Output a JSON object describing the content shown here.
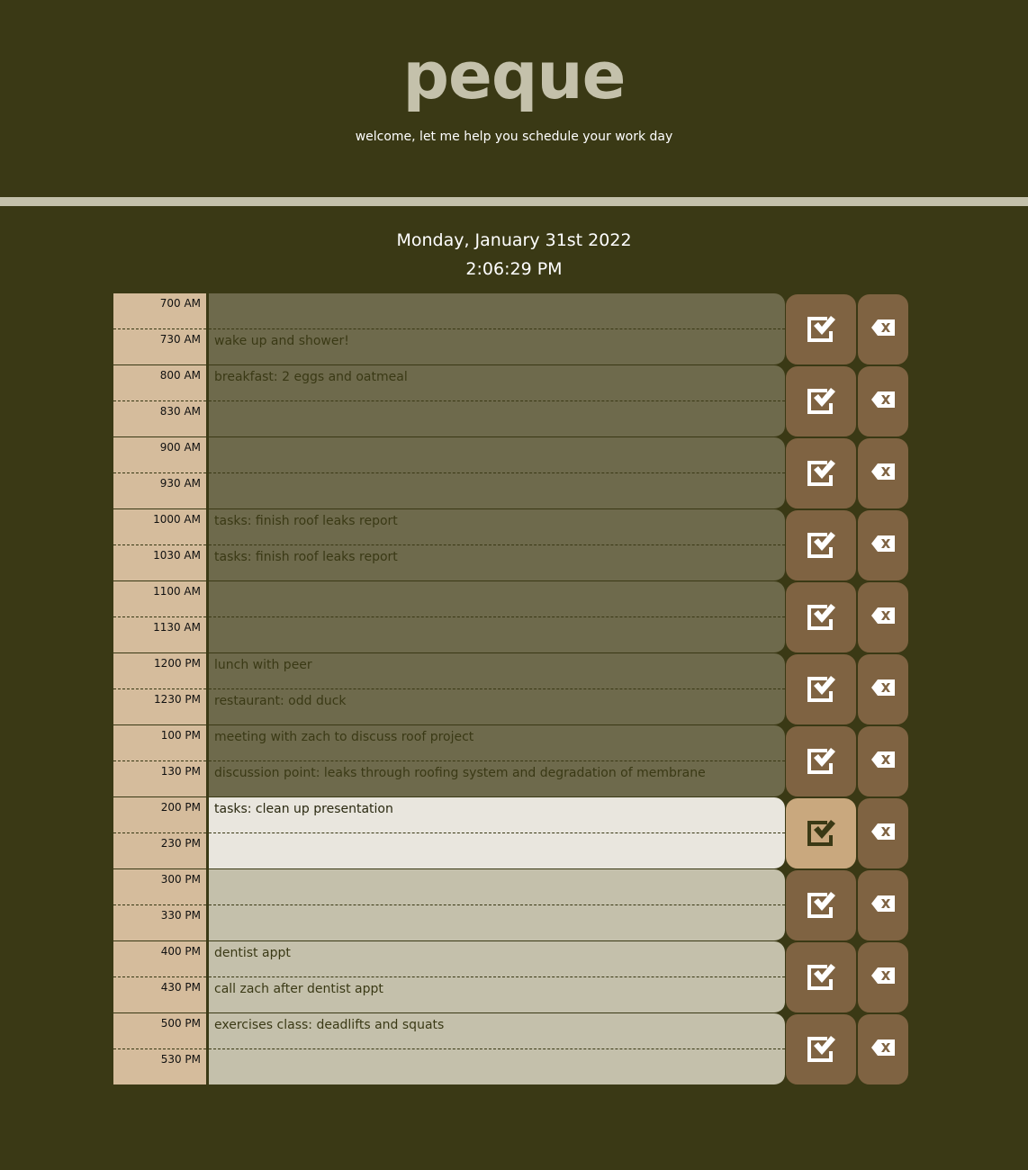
{
  "header": {
    "title": "peque",
    "subtitle": "welcome, let me help you schedule your work day"
  },
  "date": "Monday, January 31st 2022",
  "time": "2:06:29 PM",
  "colors": {
    "background": "#3a3915",
    "past": "#6e6a4c",
    "present": "#e9e6de",
    "future": "#c4c0ab",
    "time_column": "#d5bc9c",
    "button": "#7f6342",
    "present_button": "#c9a87e"
  },
  "icons": {
    "save": "check-square-icon",
    "delete": "backspace-x-icon"
  },
  "blocks": [
    {
      "state": "past",
      "slots": [
        {
          "time": "700 AM",
          "text": ""
        },
        {
          "time": "730 AM",
          "text": "wake up and shower!"
        }
      ]
    },
    {
      "state": "past",
      "slots": [
        {
          "time": "800 AM",
          "text": "breakfast: 2 eggs and oatmeal"
        },
        {
          "time": "830 AM",
          "text": ""
        }
      ]
    },
    {
      "state": "past",
      "slots": [
        {
          "time": "900 AM",
          "text": ""
        },
        {
          "time": "930 AM",
          "text": ""
        }
      ]
    },
    {
      "state": "past",
      "slots": [
        {
          "time": "1000 AM",
          "text": "tasks: finish roof leaks report"
        },
        {
          "time": "1030 AM",
          "text": "tasks: finish roof leaks report"
        }
      ]
    },
    {
      "state": "past",
      "slots": [
        {
          "time": "1100 AM",
          "text": ""
        },
        {
          "time": "1130 AM",
          "text": ""
        }
      ]
    },
    {
      "state": "past",
      "slots": [
        {
          "time": "1200 PM",
          "text": "lunch with peer"
        },
        {
          "time": "1230 PM",
          "text": "restaurant: odd duck"
        }
      ]
    },
    {
      "state": "past",
      "slots": [
        {
          "time": "100 PM",
          "text": "meeting with zach to discuss roof project"
        },
        {
          "time": "130 PM",
          "text": "discussion point: leaks through roofing system and degradation of membrane"
        }
      ]
    },
    {
      "state": "present",
      "slots": [
        {
          "time": "200 PM",
          "text": "tasks: clean up presentation"
        },
        {
          "time": "230 PM",
          "text": ""
        }
      ]
    },
    {
      "state": "future",
      "slots": [
        {
          "time": "300 PM",
          "text": ""
        },
        {
          "time": "330 PM",
          "text": ""
        }
      ]
    },
    {
      "state": "future",
      "slots": [
        {
          "time": "400 PM",
          "text": "dentist appt"
        },
        {
          "time": "430 PM",
          "text": "call zach after dentist appt"
        }
      ]
    },
    {
      "state": "future",
      "slots": [
        {
          "time": "500 PM",
          "text": "exercises class: deadlifts and squats"
        },
        {
          "time": "530 PM",
          "text": ""
        }
      ]
    }
  ]
}
